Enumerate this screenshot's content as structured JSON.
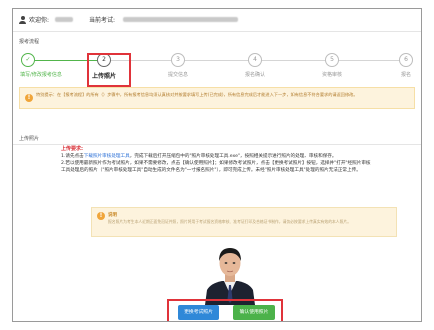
{
  "header": {
    "welcome_label": "欢迎你:",
    "current_exam_label": "当前考试:"
  },
  "steps_section_title": "报考流程",
  "steps": [
    {
      "number": "✓",
      "label": "填写/修改报考信息",
      "state": "done"
    },
    {
      "number": "2",
      "label": "上传照片",
      "state": "active"
    },
    {
      "number": "3",
      "label": "提交信息",
      "state": "pending"
    },
    {
      "number": "4",
      "label": "报名确认",
      "state": "pending"
    },
    {
      "number": "5",
      "label": "资格审核",
      "state": "pending"
    },
    {
      "number": "6",
      "label": "报名",
      "state": "pending"
    }
  ],
  "notice_text": "特别提示：在【报考流程】的所有（）步骤中，所有报考信息均须认真核对并按要求填写上传(已完成)，所有信息完成后才能进入下一步，如有信息不符合要求的请返回修改。",
  "upload_section_title": "上传照片",
  "requirements": {
    "header": "上传要求:",
    "line1_prefix": "1.请先点击",
    "line1_link": "下载照片审核处理工具",
    "line1_suffix": "，完成下载后打开压缩包中的\"照片审核处理工具.exe\"，按照相关提示进行照片的处理、审核和保存。",
    "line2": "2.若以使用最新照片作为考试照片，如果不需要修改，点击【确认使用照片】；如果修改考试照片，点击【更换考试照片】按钮，选择并\"打开\"经照片审核工具处理后的照片（\"照片审核处理工具\"自动生成的文件名为\"一寸报名照片\"），即可完成上传。未经\"照片审核处理工具\"处理的照片无法正常上传。"
  },
  "tip": {
    "title": "说明",
    "text": "报名照片为考生本人近期正面免冠证件照，照片将用于考试报名资格审核、准考证打印及合格证书制作，请务必按要求上传真实有效的本人照片。"
  },
  "buttons": {
    "change_photo": "更换考试照片",
    "confirm_photo": "确认使用照片"
  },
  "colors": {
    "done_green": "#52b54b",
    "highlight_red": "#e0333a",
    "notice_bg": "#fdf3dd",
    "blue_button": "#2f88d8",
    "green_button": "#4cb24a",
    "requirement_header": "#d9333a",
    "link_blue": "#2a6fd6"
  }
}
